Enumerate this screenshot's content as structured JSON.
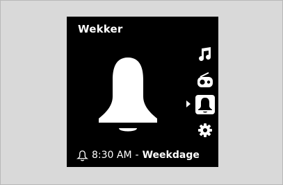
{
  "screen": {
    "title": "Wekker",
    "big_icon": "alarm-bell-icon",
    "menu": [
      {
        "icon": "music-note-icon",
        "selected": false
      },
      {
        "icon": "radio-icon",
        "selected": false
      },
      {
        "icon": "alarm-bell-icon",
        "selected": true
      },
      {
        "icon": "gear-icon",
        "selected": false
      }
    ],
    "status": {
      "icon": "bell-outline-icon",
      "time": "8:30 AM",
      "separator": "-",
      "days": "Weekdage"
    }
  },
  "colors": {
    "background": "#d9d9d9",
    "screen": "#000000",
    "foreground": "#ffffff"
  }
}
